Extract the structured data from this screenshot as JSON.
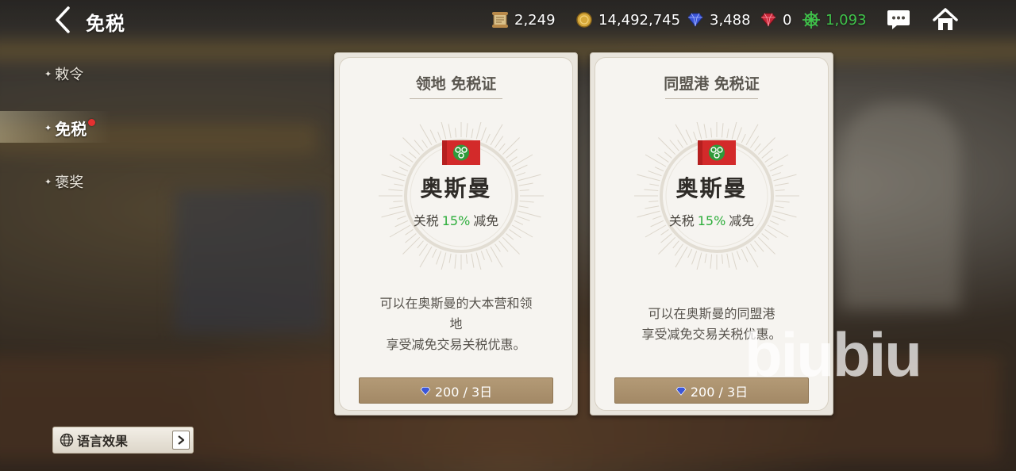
{
  "header": {
    "title": "免税"
  },
  "resources": [
    {
      "icon": "scroll-icon",
      "value": "2,249"
    },
    {
      "icon": "gold-coin-icon",
      "value": "14,492,745"
    },
    {
      "icon": "sapphire-icon",
      "value": "3,488"
    },
    {
      "icon": "ruby-icon",
      "value": "0"
    },
    {
      "icon": "ship-wheel-icon",
      "value": "1,093",
      "color": "#3fc34a"
    }
  ],
  "sidebar": {
    "items": [
      {
        "label": "敕令",
        "active": false
      },
      {
        "label": "免税",
        "active": true,
        "badge": true
      },
      {
        "label": "褒奖",
        "active": false
      }
    ],
    "language_button": "语言效果"
  },
  "cards": [
    {
      "title": "领地 免税证",
      "nation": "奥斯曼",
      "tariff_prefix": "关税",
      "tariff_pct": "15%",
      "tariff_suffix": "减免",
      "desc_lines": [
        "可以在奥斯曼的大本营和领",
        "地",
        "享受减免交易关税优惠。"
      ],
      "price": "200 / 3日"
    },
    {
      "title": "同盟港 免税证",
      "nation": "奥斯曼",
      "tariff_prefix": "关税",
      "tariff_pct": "15%",
      "tariff_suffix": "减免",
      "desc_lines": [
        "可以在奥斯曼的同盟港",
        "享受减免交易关税优惠。"
      ],
      "price": "200 / 3日"
    }
  ],
  "watermark": "biubiu",
  "colors": {
    "accent_green": "#2eae3c",
    "button_brown": "#a38966",
    "badge_red": "#e53030"
  }
}
